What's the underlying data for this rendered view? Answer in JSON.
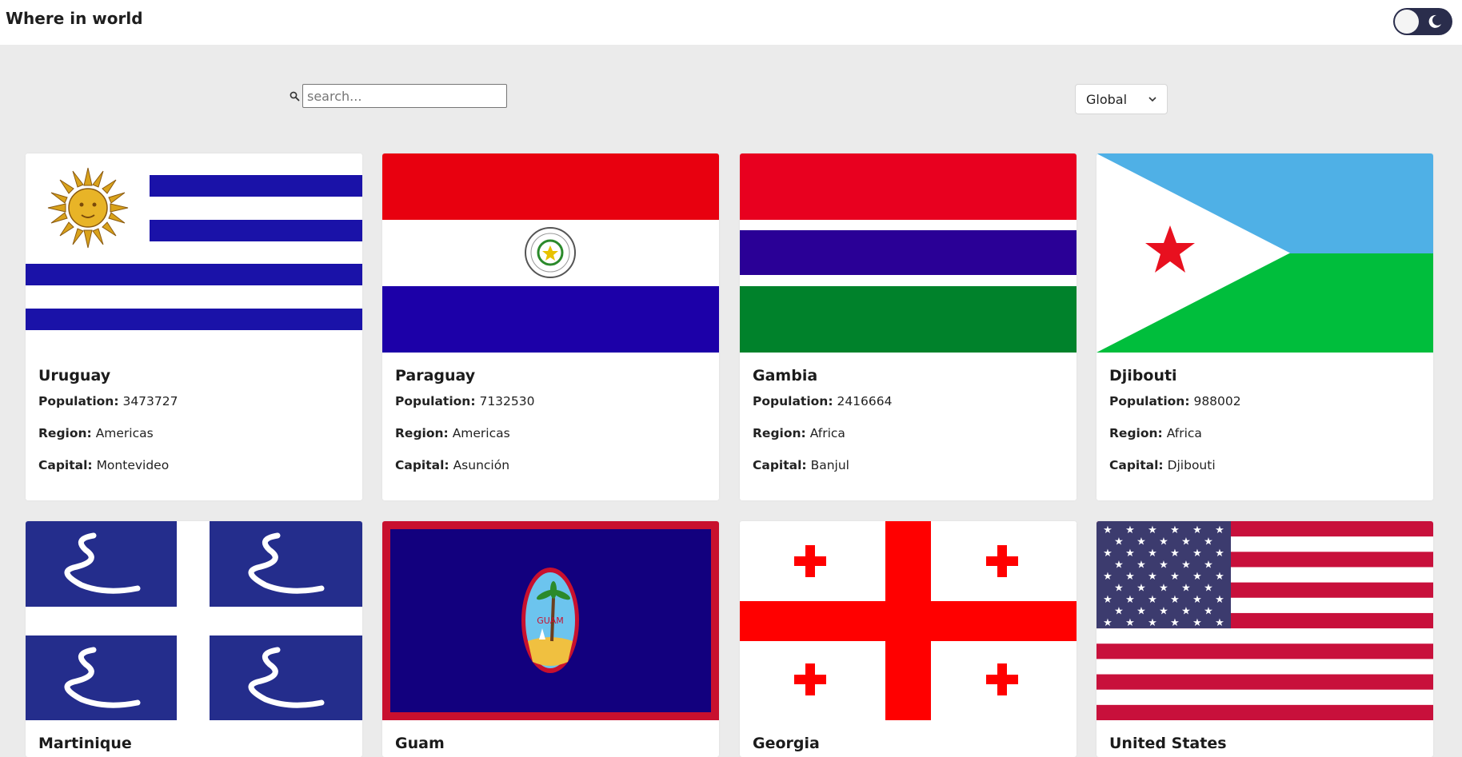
{
  "header": {
    "title": "Where in world"
  },
  "search": {
    "placeholder": "search..."
  },
  "region_filter": {
    "selected": "Global"
  },
  "labels": {
    "population": "Population:",
    "region": "Region:",
    "capital": "Capital:"
  },
  "countries": [
    {
      "name": "Uruguay",
      "population": "3473727",
      "region": "Americas",
      "capital": "Montevideo",
      "flag": "uruguay-flag"
    },
    {
      "name": "Paraguay",
      "population": "7132530",
      "region": "Americas",
      "capital": "Asunción",
      "flag": "paraguay-flag"
    },
    {
      "name": "Gambia",
      "population": "2416664",
      "region": "Africa",
      "capital": "Banjul",
      "flag": "gambia-flag"
    },
    {
      "name": "Djibouti",
      "population": "988002",
      "region": "Africa",
      "capital": "Djibouti",
      "flag": "djibouti-flag"
    },
    {
      "name": "Martinique",
      "flag": "martinique-flag"
    },
    {
      "name": "Guam",
      "flag": "guam-flag"
    },
    {
      "name": "Georgia",
      "flag": "georgia-flag"
    },
    {
      "name": "United States",
      "flag": "united-states-flag"
    }
  ],
  "icons": {
    "theme_toggle": "moon-icon",
    "search": "search-icon",
    "dropdown": "chevron-down-icon"
  },
  "colors": {
    "toggle_track": "#2a2d4c",
    "page_background": "#ebebeb"
  }
}
